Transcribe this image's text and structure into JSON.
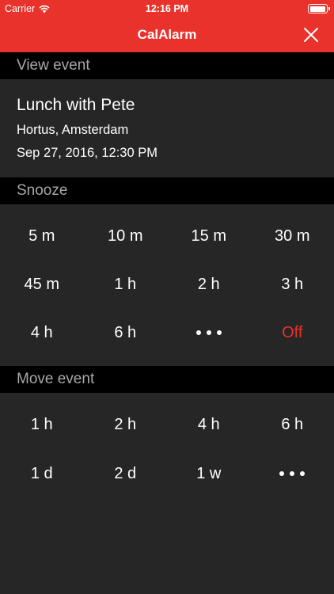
{
  "status_bar": {
    "carrier": "Carrier",
    "time": "12:16 PM"
  },
  "nav": {
    "title": "CalAlarm",
    "close_icon": "close-icon"
  },
  "view_event": {
    "header": "View event",
    "name": "Lunch with Pete",
    "location": "Hortus, Amsterdam",
    "datetime": "Sep 27, 2016, 12:30 PM"
  },
  "snooze": {
    "header": "Snooze",
    "options": [
      "5 m",
      "10 m",
      "15 m",
      "30 m",
      "45 m",
      "1 h",
      "2 h",
      "3 h",
      "4 h",
      "6 h",
      "more-icon",
      "Off"
    ]
  },
  "move_event": {
    "header": "Move event",
    "options": [
      "1 h",
      "2 h",
      "4 h",
      "6 h",
      "1 d",
      "2 d",
      "1 w",
      "more-icon"
    ]
  },
  "colors": {
    "accent": "#e8322b",
    "background": "#262626",
    "header_bg": "#000000",
    "header_text": "#a8a8a8"
  }
}
